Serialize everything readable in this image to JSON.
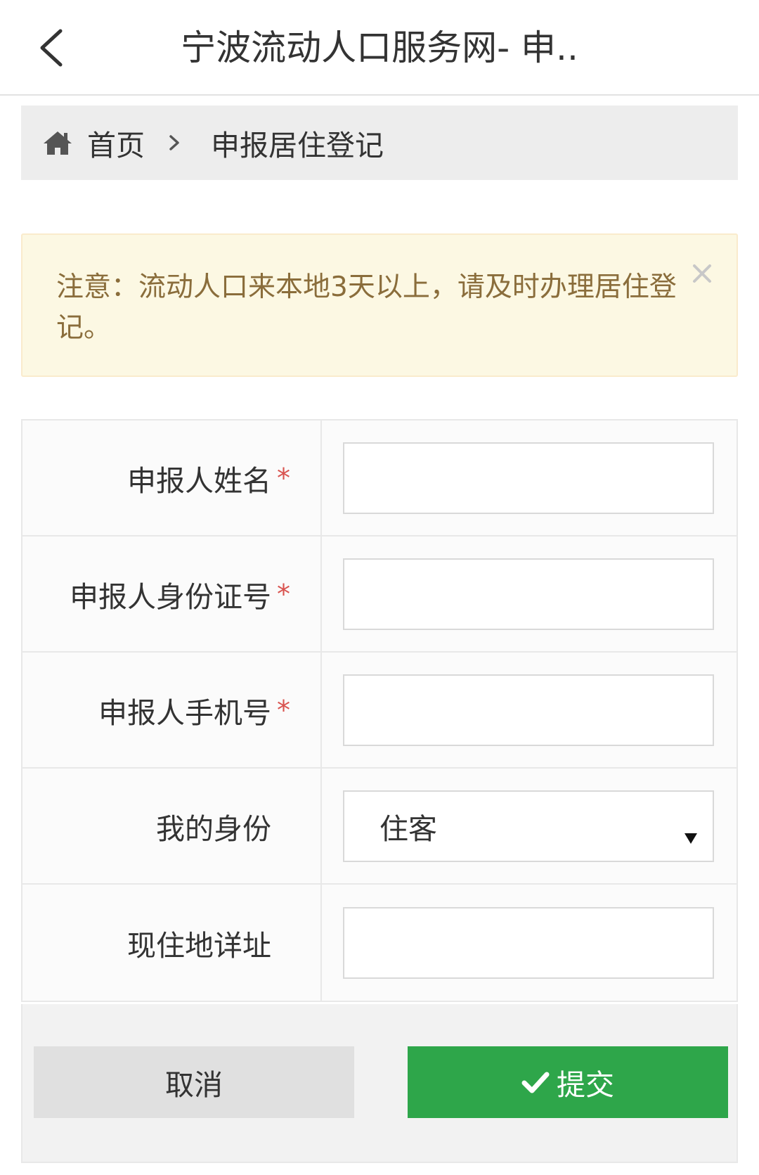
{
  "header": {
    "title": "宁波流动人口服务网- 申.."
  },
  "breadcrumb": {
    "home_label": "首页",
    "current_label": "申报居住登记"
  },
  "alert": {
    "message": "注意：流动人口来本地3天以上，请及时办理居住登记。"
  },
  "form": {
    "name": {
      "label": "申报人姓名",
      "required_mark": "*",
      "value": ""
    },
    "id_number": {
      "label": "申报人身份证号",
      "required_mark": "*",
      "value": ""
    },
    "phone": {
      "label": "申报人手机号",
      "required_mark": "*",
      "value": ""
    },
    "identity": {
      "label": "我的身份",
      "selected": "住客"
    },
    "address": {
      "label": "现住地详址",
      "value": ""
    }
  },
  "actions": {
    "cancel_label": "取消",
    "submit_label": "提交"
  },
  "colors": {
    "alert_text": "#8a6d3b",
    "alert_bg": "#fcf8e3",
    "required": "#d9534f",
    "submit_bg": "#2ea64a"
  },
  "icons": {
    "back": "chevron-left-icon",
    "home": "home-icon",
    "separator": "chevron-right-icon",
    "close": "close-icon",
    "dropdown": "triangle-down-icon",
    "check": "check-icon"
  }
}
